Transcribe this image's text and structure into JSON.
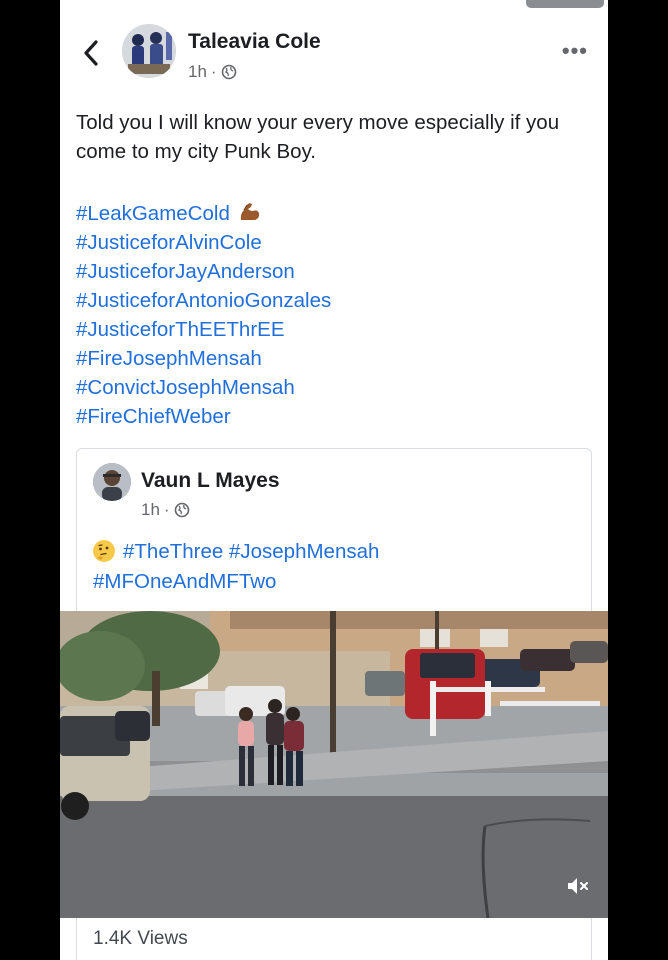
{
  "post": {
    "author": "Taleavia Cole",
    "time": "1h",
    "separator": "·",
    "text": "Told you I will know your every move especially if you come to my city Punk Boy.",
    "hashtags": [
      "#LeakGameCold",
      "#JusticeforAlvinCole",
      "#JusticeforJayAnderson",
      "#JusticeforAntonioGonzales",
      "#JusticeforThEEThrEE",
      "#FireJosephMensah",
      "#ConvictJosephMensah",
      "#FireChiefWeber"
    ],
    "more_label": "•••"
  },
  "shared_post": {
    "author": "Vaun L Mayes",
    "time": "1h",
    "separator": "·",
    "line1": "#TheThree #JosephMensah",
    "line2": "#MFOneAndMFTwo"
  },
  "video": {
    "views": "1.4K Views"
  },
  "icons": {
    "back": "chevron-left-icon",
    "privacy": "globe-icon",
    "more": "more-dots-icon",
    "flex": "flexed-biceps-emoji",
    "thinking": "thinking-face-emoji",
    "mute": "speaker-muted-icon"
  },
  "colors": {
    "link": "#216fdb",
    "text": "#1c1e21",
    "meta": "#65676b"
  }
}
